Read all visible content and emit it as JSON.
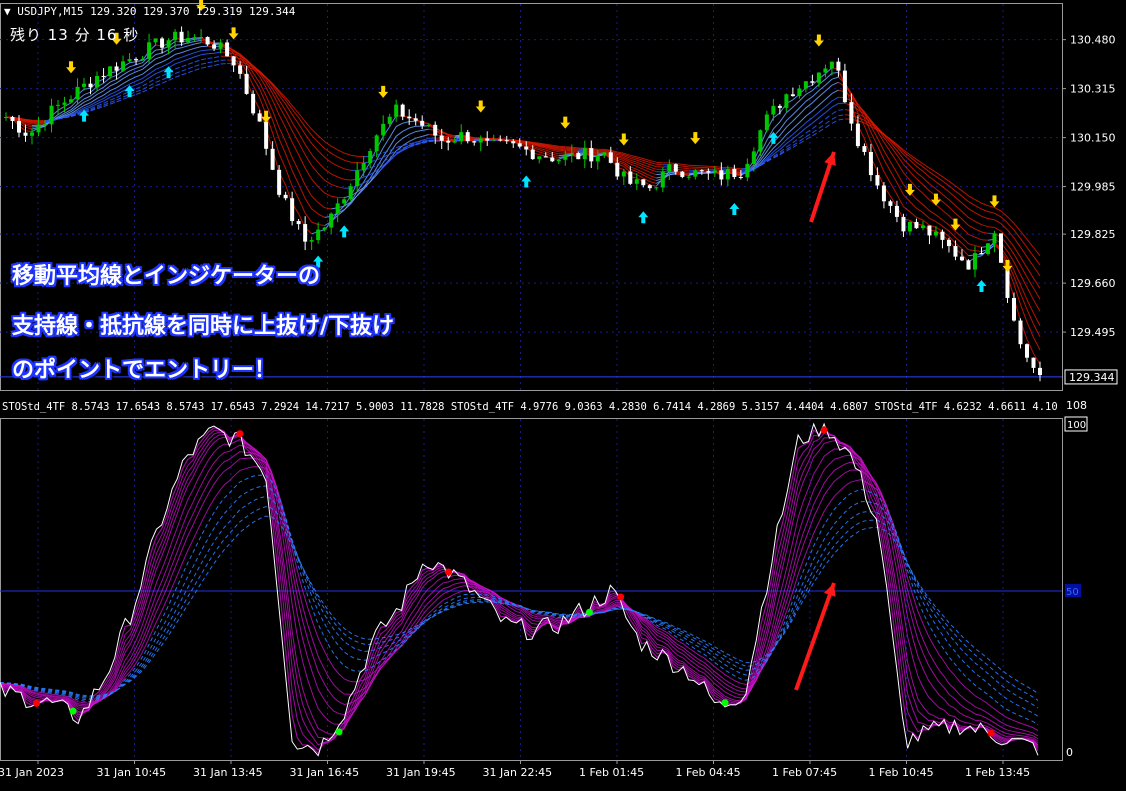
{
  "header": {
    "symbol_line": "USDJPY,M15  129.320 129.370 129.319 129.344",
    "timer": "残り 13 分 16 秒"
  },
  "captions": [
    "移動平均線とインジケーターの",
    "支持線・抵抗線を同時に上抜け/下抜け",
    "のポイントでエントリー！"
  ],
  "indicator_line": "STOStd_4TF 8.5743 17.6543 8.5743 17.6543 7.2924 14.7217 5.9003 11.7828   STOStd_4TF 4.9776 9.0363 4.2830 6.7414 4.2869 5.3157 4.4404 4.6807   STOStd_4TF 4.6232 4.6611 4.10",
  "colors": {
    "bull": "#00c800",
    "bear": "#ffffff",
    "ma_red": "#d81800",
    "ma_blue": "#2a5cff",
    "stoch_magenta": "#d010d0",
    "grid": "#1a1a8c",
    "arrow_up": "#00e5ff",
    "arrow_down": "#ffd400",
    "annotation_arrow": "#ff1a1a",
    "signal_buy": "#00ff00",
    "signal_sell": "#ff0000"
  },
  "chart_data": [
    {
      "type": "candlestick",
      "title": "USDJPY,M15",
      "ylim": [
        129.3,
        130.6
      ],
      "price_labels": [
        "130.480",
        "130.315",
        "130.150",
        "129.985",
        "129.825",
        "129.660",
        "129.495"
      ],
      "current_price": "129.344",
      "x_labels": [
        "31 Jan 2023",
        "31 Jan 10:45",
        "31 Jan 13:45",
        "31 Jan 16:45",
        "31 Jan 19:45",
        "31 Jan 22:45",
        "1 Feb 01:45",
        "1 Feb 04:45",
        "1 Feb 07:45",
        "1 Feb 10:45",
        "1 Feb 13:45"
      ],
      "close_path": [
        130.22,
        130.16,
        130.24,
        130.3,
        130.36,
        130.4,
        130.44,
        130.48,
        130.49,
        130.47,
        130.4,
        130.2,
        129.95,
        129.8,
        129.86,
        130.0,
        130.15,
        130.24,
        130.2,
        130.14,
        130.16,
        130.12,
        130.12,
        130.1,
        130.08,
        130.09,
        130.1,
        130.0,
        129.98,
        130.05,
        130.03,
        130.02,
        130.04,
        130.2,
        130.3,
        130.35,
        130.42,
        130.16,
        129.98,
        129.86,
        129.84,
        129.78,
        129.72,
        129.85,
        129.48,
        129.33
      ]
    },
    {
      "type": "line",
      "title": "STOStd_4TF",
      "ylim": [
        0,
        108
      ],
      "y_labels": [
        "108",
        "100",
        "50",
        "0"
      ],
      "main_line": [
        20,
        18,
        16,
        12,
        25,
        45,
        70,
        90,
        98,
        95,
        85,
        5,
        3,
        15,
        35,
        45,
        60,
        55,
        48,
        40,
        38,
        40,
        45,
        50,
        35,
        30,
        25,
        15,
        20,
        60,
        95,
        100,
        90,
        70,
        5,
        8,
        10,
        8,
        5,
        3
      ],
      "buy_signal_count": 4,
      "sell_signal_count": 5
    }
  ]
}
